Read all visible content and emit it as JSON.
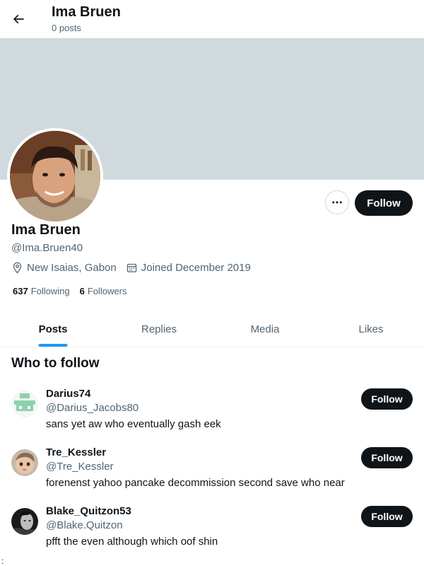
{
  "header": {
    "title": "Ima Bruen",
    "subtitle": "0 posts",
    "back_icon": "arrow-left-icon"
  },
  "banner": {
    "color": "#cfd9de"
  },
  "profile": {
    "name": "Ima Bruen",
    "handle": "@Ima.Bruen40",
    "location": "New Isaias, Gabon",
    "joined": "Joined December 2019",
    "following_count": "637",
    "following_label": "Following",
    "followers_count": "6",
    "followers_label": "Followers",
    "follow_label": "Follow",
    "more_icon": "more-horizontal-icon"
  },
  "tabs": [
    {
      "label": "Posts",
      "active": true
    },
    {
      "label": "Replies",
      "active": false
    },
    {
      "label": "Media",
      "active": false
    },
    {
      "label": "Likes",
      "active": false
    }
  ],
  "who_to_follow": {
    "title": "Who to follow",
    "users": [
      {
        "name": "Darius74",
        "handle": "@Darius_Jacobs80",
        "bio": "sans yet aw who eventually gash eek",
        "follow_label": "Follow"
      },
      {
        "name": "Tre_Kessler",
        "handle": "@Tre_Kessler",
        "bio": "forenenst yahoo pancake decommission second save who near",
        "follow_label": "Follow"
      },
      {
        "name": "Blake_Quitzon53",
        "handle": "@Blake.Quitzon",
        "bio": "pfft the even although which oof shin",
        "follow_label": "Follow"
      }
    ]
  },
  "colors": {
    "accent": "#1d9bf0",
    "button": "#0f1419",
    "secondary_text": "#536471"
  },
  "stray_text": ":"
}
